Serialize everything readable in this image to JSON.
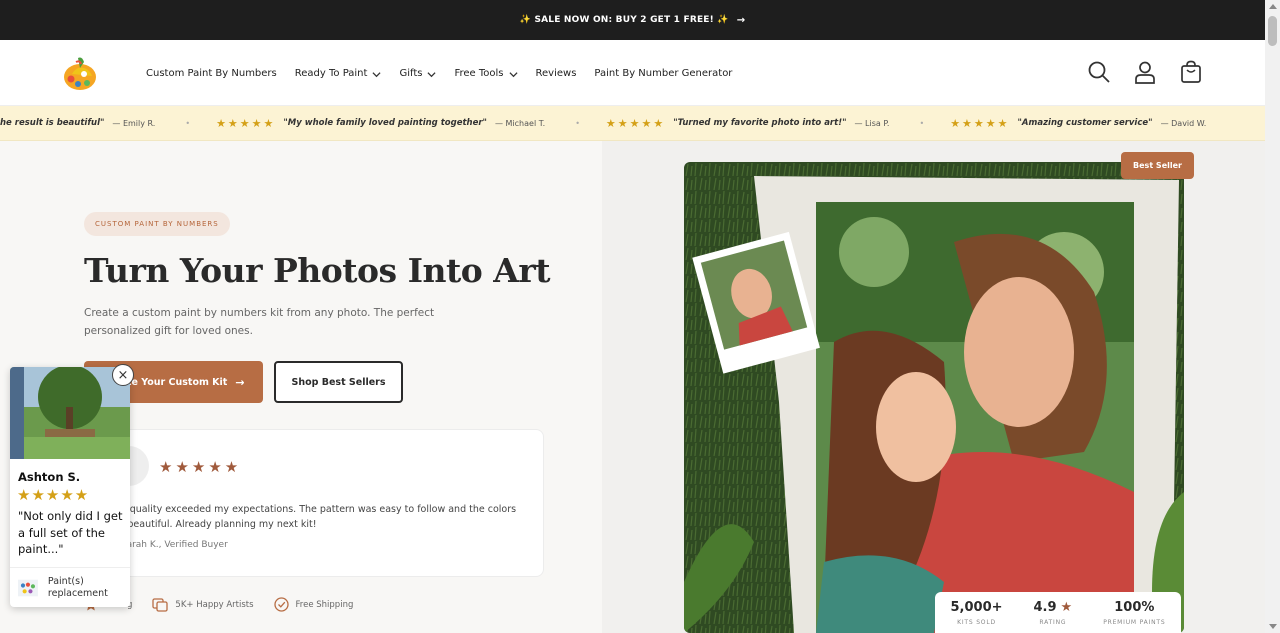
{
  "announcement": {
    "text": "✨ SALE NOW ON: BUY 2 GET 1 FREE! ✨",
    "arrow": "→"
  },
  "nav": {
    "items": [
      {
        "label": "Custom Paint By Numbers",
        "dropdown": false
      },
      {
        "label": "Ready To Paint",
        "dropdown": true
      },
      {
        "label": "Gifts",
        "dropdown": true
      },
      {
        "label": "Free Tools",
        "dropdown": true
      },
      {
        "label": "Reviews",
        "dropdown": false
      },
      {
        "label": "Paint By Number Generator",
        "dropdown": false
      }
    ],
    "icons": [
      "search-icon",
      "account-icon",
      "cart-icon"
    ]
  },
  "ticker": {
    "items": [
      {
        "stars": "",
        "quote": "ng and the result is beautiful\"",
        "author": "— Emily R."
      },
      {
        "stars": "★★★★★",
        "quote": "\"My whole family loved painting together\"",
        "author": "— Michael T."
      },
      {
        "stars": "★★★★★",
        "quote": "\"Turned my favorite photo into art!\"",
        "author": "— Lisa P."
      },
      {
        "stars": "★★★★★",
        "quote": "\"Amazing customer service\"",
        "author": "— David W."
      }
    ],
    "star_color": "#d4a017"
  },
  "hero": {
    "badge": "CUSTOM PAINT BY NUMBERS",
    "title": "Turn Your Photos Into Art",
    "subtitle": "Create a custom paint by numbers kit from any photo. The perfect personalized gift for loved ones.",
    "primary_button": "Create Your Custom Kit",
    "secondary_button": "Shop Best Sellers",
    "review": {
      "stars": "★★★★★",
      "text": "The quality exceeded my expectations. The pattern was easy to follow and the colors are beautiful. Already planning my next kit!",
      "author": "— Sarah K., Verified Buyer"
    },
    "trust": {
      "rating": "Rating",
      "artists": "5K+ Happy Artists",
      "shipping": "Free Shipping"
    },
    "best_seller_badge": "Best Seller",
    "stats": [
      {
        "value": "5,000+",
        "label": "KITS SOLD",
        "star": false
      },
      {
        "value": "4.9",
        "label": "RATING",
        "star": true
      },
      {
        "value": "100%",
        "label": "PREMIUM PAINTS",
        "star": false
      }
    ],
    "accent_color": "#b76d44"
  },
  "popup": {
    "name": "Ashton S.",
    "stars": "★★★★★",
    "text": "\"Not only did I get a full set of the paint...\"",
    "product": "Paint(s) replacement",
    "close": "×"
  }
}
